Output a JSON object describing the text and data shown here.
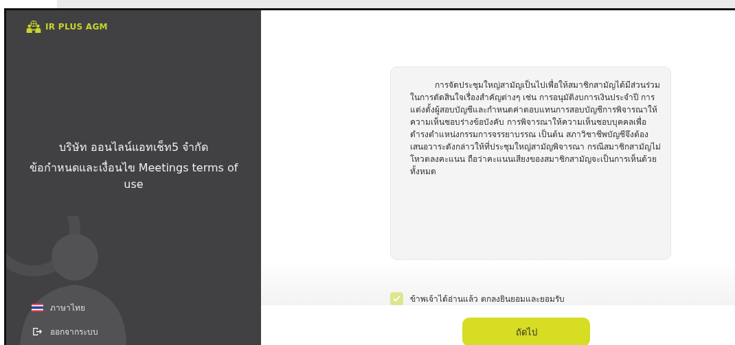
{
  "brand": {
    "name": "IR PLUS AGM"
  },
  "sidebar": {
    "company": "บริษัท ออนไลน์แอทเช็ท5 จำกัด",
    "heading": "ข้อกำหนดและเงื่อนไข Meetings terms of use",
    "items": [
      {
        "kind": "language",
        "label": "ภาษาไทย"
      },
      {
        "kind": "logout",
        "label": "ออกจากระบบ"
      }
    ]
  },
  "terms": {
    "text": "การจัดประชุมใหญ่สามัญเป็นไปเพื่อให้สมาชิกสามัญได้มีส่วนร่วมในการตัดสินใจเรื่องสำคัญต่างๆ เช่น การอนุมัติงบการเงินประจำปี การแต่งตั้งผู้สอบบัญชีและกำหนดค่าตอบแทนการสอบบัญชีการพิจารณาให้ความเห็นชอบร่างข้อบังคับ การพิจารณาให้ความเห็นชอบบุคคลเพื่อดำรงตำแหน่งกรรมการจรรยาบรรณ เป็นต้น สภาวิชาชีพบัญชีจึงต้องเสนอวาระดังกล่าวให้ที่ประชุมใหญ่สามัญพิจารณา กรณีสมาชิกสามัญไม่โหวตลงคะแนน ถือว่าคะแนนเสียงของสมาชิกสามัญจะเป็นการเห็นด้วยทั้งหมด"
  },
  "agreement": {
    "label": "ข้าพเจ้าได้อ่านแล้ว ตกลงยินยอมและยอมรับ",
    "checked": true
  },
  "next_button": {
    "label": "ถัดไป"
  }
}
